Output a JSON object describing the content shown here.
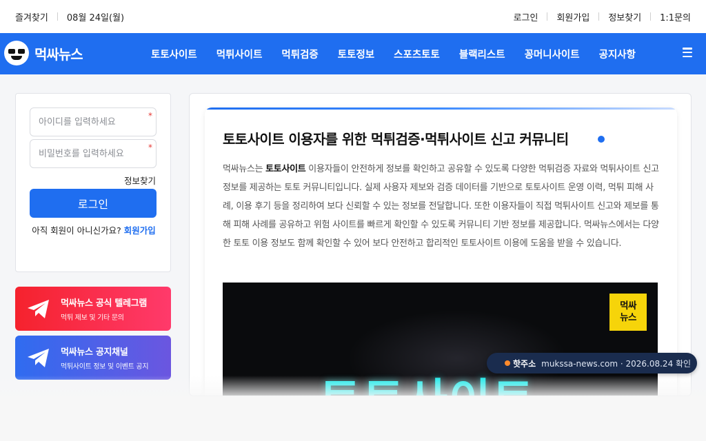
{
  "topbar": {
    "favorites": "즐겨찾기",
    "date": "08월 24일(월)",
    "links": [
      "로그인",
      "회원가입",
      "정보찾기",
      "1:1문의"
    ]
  },
  "nav": {
    "logo_text": "먹싸뉴스",
    "menu": [
      "토토사이트",
      "먹튀사이트",
      "먹튀검증",
      "토토정보",
      "스포츠토토",
      "블랙리스트",
      "꽁머니사이트",
      "공지사항"
    ],
    "menu_icon": "hamburger-icon",
    "brand_color": "#1f6ef0"
  },
  "login": {
    "id_placeholder": "아이디를 입력하세요",
    "pw_placeholder": "비밀번호를 입력하세요",
    "required_mark": "*",
    "find_info": "정보찾기",
    "button": "로그인",
    "signup_prompt": "아직 회원이 아니신가요?",
    "signup_link": "회원가입"
  },
  "telegram": [
    {
      "title": "먹싸뉴스 공식 텔레그램",
      "subtitle": "먹튀 제보 및 기타 문의",
      "icon": "telegram-icon",
      "color": "#f5222d"
    },
    {
      "title": "먹싸뉴스 공지채널",
      "subtitle": "먹튀사이트 정보 및 이벤트 공지",
      "icon": "telegram-icon",
      "color": "#2f6cf0"
    }
  ],
  "article": {
    "title": "토토사이트 이용자를 위한 먹튀검증·먹튀사이트 신고 커뮤니티",
    "desc_prefix": "먹싸뉴스는 ",
    "desc_bold": "토토사이트",
    "desc_rest": " 이용자들이 안전하게 정보를 확인하고 공유할 수 있도록 다양한 먹튀검증 자료와 먹튀사이트 신고 정보를 제공하는 토토 커뮤니티입니다. 실제 사용자 제보와 검증 데이터를 기반으로 토토사이트 운영 이력, 먹튀 피해 사례, 이용 후기 등을 정리하여 보다 신뢰할 수 있는 정보를 전달합니다. 또한 이용자들이 직접 먹튀사이트 신고와 제보를 통해 피해 사례를 공유하고 위험 사이트를 빠르게 확인할 수 있도록 커뮤니티 기반 정보를 제공합니다. 먹싸뉴스에서는 다양한 토토 이용 정보도 함께 확인할 수 있어 보다 안전하고 합리적인 토토사이트 이용에 도움을 받을 수 있습니다.",
    "banner_mark_line1": "먹싸",
    "banner_mark_line2": "뉴스",
    "banner_text": "토토사이트"
  },
  "hot_address": {
    "label": "핫주소",
    "text": "mukssa-news.com · 2026.08.24 확인"
  }
}
